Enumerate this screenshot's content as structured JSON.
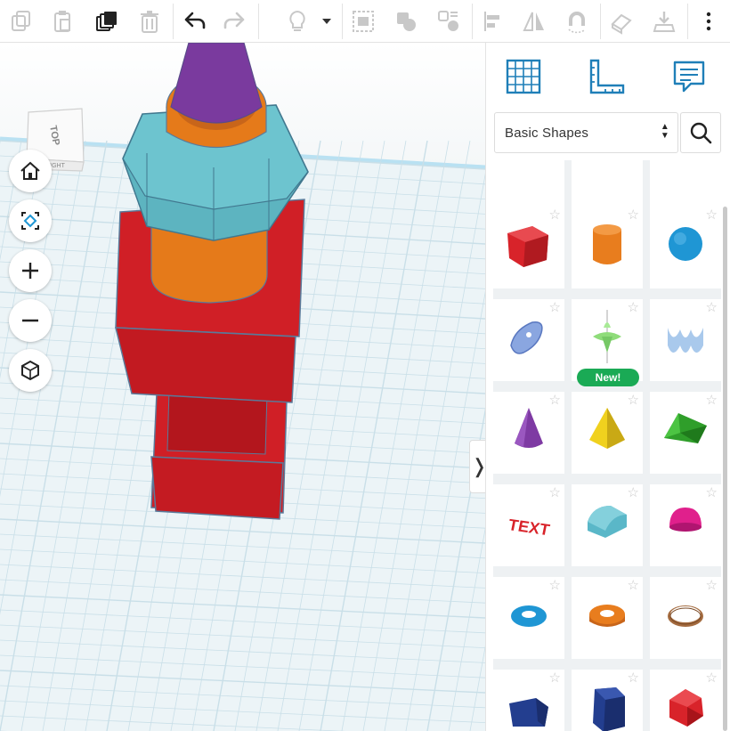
{
  "toolbar": {
    "buttons": [
      {
        "name": "copy-icon",
        "enabled": false
      },
      {
        "name": "paste-icon",
        "enabled": false
      },
      {
        "name": "duplicate-icon",
        "enabled": true
      },
      {
        "name": "delete-icon",
        "enabled": false
      },
      {
        "name": "undo-icon",
        "enabled": true
      },
      {
        "name": "redo-icon",
        "enabled": false
      },
      {
        "name": "lightbulb-icon",
        "enabled": false
      },
      {
        "name": "dropdown-arrow-icon",
        "enabled": true
      },
      {
        "name": "workplane-icon",
        "enabled": false
      },
      {
        "name": "group-icon",
        "enabled": false
      },
      {
        "name": "ungroup-icon",
        "enabled": false
      },
      {
        "name": "align-icon",
        "enabled": false
      },
      {
        "name": "mirror-icon",
        "enabled": false
      },
      {
        "name": "magnet-icon",
        "enabled": false
      },
      {
        "name": "ruler-icon",
        "enabled": false
      },
      {
        "name": "import-icon",
        "enabled": false
      },
      {
        "name": "more-icon",
        "enabled": true
      }
    ]
  },
  "view_cube": {
    "top_label": "TOP",
    "side_label": "RIGHT"
  },
  "view_controls": [
    "home-view-icon",
    "fit-view-icon",
    "zoom-in-icon",
    "zoom-out-icon",
    "perspective-icon"
  ],
  "panel": {
    "tabs": [
      "grid-icon",
      "ruler-tab-icon",
      "notes-icon"
    ],
    "library_select": {
      "value": "Basic Shapes"
    },
    "search": "search-icon",
    "shapes": [
      {
        "name": "box-stripes-partial",
        "color": "#9aa0a6"
      },
      {
        "name": "cylinder-stripes-partial",
        "color": "#9aa0a6"
      },
      {
        "name": "sphere-stripes-partial",
        "color": "#9aa0a6"
      },
      {
        "name": "box",
        "color": "#d8232a"
      },
      {
        "name": "cylinder",
        "color": "#e87d1e"
      },
      {
        "name": "sphere",
        "color": "#1f96d4"
      },
      {
        "name": "scribble",
        "color": "#8aa6e0"
      },
      {
        "name": "spinner",
        "color": "#8fdc7a",
        "badge": "New!"
      },
      {
        "name": "text-wavy",
        "color": "#a9c9ec"
      },
      {
        "name": "cone",
        "color": "#7e3aa3"
      },
      {
        "name": "pyramid",
        "color": "#f0d11e"
      },
      {
        "name": "roof",
        "color": "#2f9e2a"
      },
      {
        "name": "text",
        "color": "#d8232a",
        "label": "TEXT"
      },
      {
        "name": "half-cylinder",
        "color": "#5ab7c8"
      },
      {
        "name": "half-sphere",
        "color": "#e0208c"
      },
      {
        "name": "torus",
        "color": "#1f96d4"
      },
      {
        "name": "tube",
        "color": "#e87d1e"
      },
      {
        "name": "ring",
        "color": "#a46b3f"
      },
      {
        "name": "wedge-polygon",
        "color": "#233e8f"
      },
      {
        "name": "polygon",
        "color": "#233e8f"
      },
      {
        "name": "icosahedron",
        "color": "#d8232a"
      }
    ]
  }
}
